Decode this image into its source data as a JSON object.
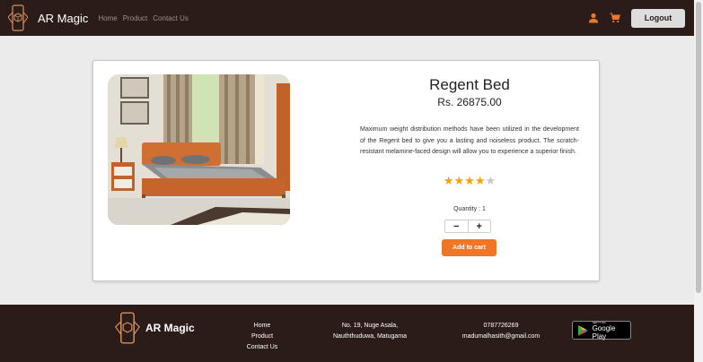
{
  "navbar": {
    "brand": "AR Magic",
    "links": [
      "Home",
      "Product",
      "Contact Us"
    ],
    "logout_label": "Logout"
  },
  "product": {
    "title": "Regent Bed",
    "price": "Rs. 26875.00",
    "description": "Maximum weight distribution methods have been utilized in the development of the Regent bed to give you a lasting and noiseless product. The scratch-resistant melamine-faced design will allow you to experience a superior finish.",
    "rating": 4,
    "rating_max": 5,
    "quantity_label": "Quantity : 1",
    "decrement": "−",
    "increment": "+",
    "add_to_cart_label": "Add to cart"
  },
  "footer": {
    "brand": "AR Magic",
    "links": [
      "Home",
      "Product",
      "Contact Us"
    ],
    "address_line1": "No. 19, Nuge Asala,",
    "address_line2": "Nauththuduwa, Matugama",
    "phone": "0787726269",
    "email": "madumalhasith@gmail.com",
    "store_badge_small": "GET IT ON",
    "store_badge_big": "Google Play"
  },
  "colors": {
    "navbar_bg": "#2b1c1a",
    "accent_orange": "#f07525",
    "star_filled": "#f4a10a",
    "star_empty": "#c8c8c8"
  },
  "icons": [
    "ar-logo-icon",
    "user-icon",
    "cart-icon",
    "play-store-icon"
  ]
}
